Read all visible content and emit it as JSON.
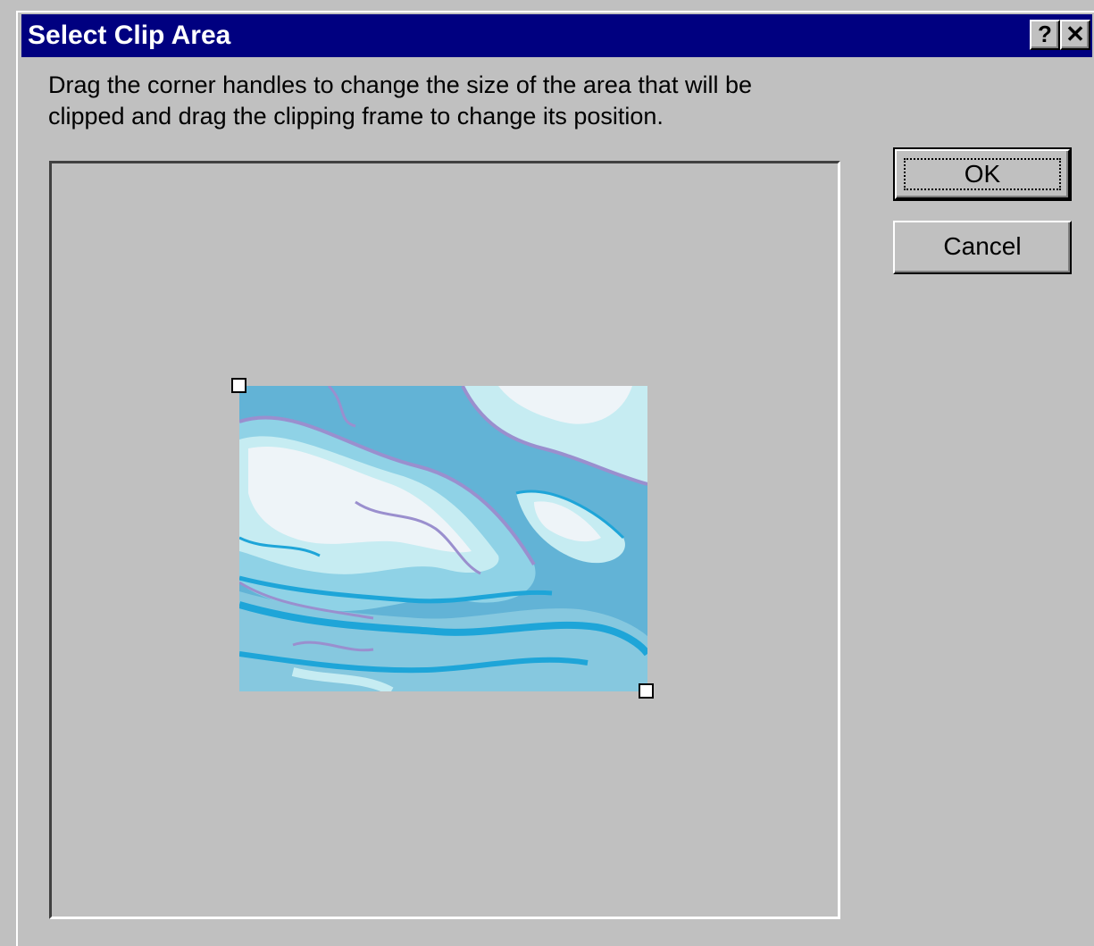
{
  "window": {
    "title": "Select Clip Area",
    "help_glyph": "?",
    "close_glyph": "✕",
    "icons": [
      "help-icon",
      "close-icon"
    ]
  },
  "instructions": {
    "line1": "Drag the corner handles to change the size of the area that will be",
    "line2": "clipped and drag the clipping frame to change its position."
  },
  "buttons": {
    "ok_label": "OK",
    "cancel_label": "Cancel"
  },
  "colors": {
    "title_bar": "#000080",
    "dialog_face": "#c0c0c0",
    "clip_palette": [
      "#62b3d6",
      "#1ea5d8",
      "#8fd2e6",
      "#c6ecf2",
      "#eef4f8",
      "#9a8fce",
      "#86c8df"
    ]
  }
}
